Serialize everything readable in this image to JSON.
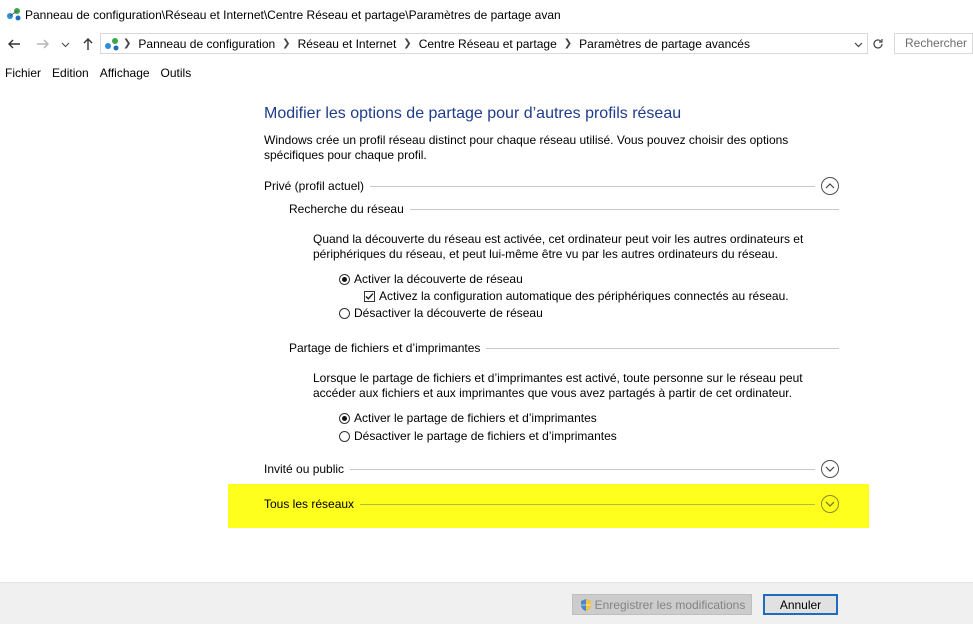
{
  "window": {
    "title": "Panneau de configuration\\Réseau et Internet\\Centre Réseau et partage\\Paramètres de partage avan"
  },
  "nav": {
    "back_icon": "arrow-left-icon",
    "forward_icon": "arrow-right-icon",
    "recent_icon": "chevron-down-icon",
    "up_icon": "arrow-up-icon",
    "breadcrumbs": [
      "Panneau de configuration",
      "Réseau et Internet",
      "Centre Réseau et partage",
      "Paramètres de partage avancés"
    ],
    "search_placeholder": "Rechercher"
  },
  "menu": [
    "Fichier",
    "Edition",
    "Affichage",
    "Outils"
  ],
  "content": {
    "title": "Modifier les options de partage pour d’autres profils réseau",
    "intro": "Windows crée un profil réseau distinct pour chaque réseau utilisé. Vous pouvez choisir des options spécifiques pour chaque profil.",
    "private_profile": {
      "label": "Privé (profil actuel)",
      "expanded": true,
      "network_discovery": {
        "heading": "Recherche du réseau",
        "description": "Quand la découverte du réseau est activée, cet ordinateur peut voir les autres ordinateurs et périphériques du réseau, et peut lui-même être vu par les autres ordinateurs du réseau.",
        "enable_label": "Activer la découverte de réseau",
        "enable_selected": true,
        "auto_config_label": "Activez la configuration automatique des périphériques connectés au réseau.",
        "auto_config_checked": true,
        "disable_label": "Désactiver la découverte de réseau"
      },
      "file_sharing": {
        "heading": "Partage de fichiers et d’imprimantes",
        "description": "Lorsque le partage de fichiers et d’imprimantes est activé, toute personne sur le réseau peut accéder aux fichiers et aux imprimantes que vous avez partagés à partir de cet ordinateur.",
        "enable_label": "Activer le partage de fichiers et d’imprimantes",
        "enable_selected": true,
        "disable_label": "Désactiver le partage de fichiers et d’imprimantes"
      }
    },
    "guest_profile": {
      "label": "Invité ou public",
      "expanded": false
    },
    "all_networks": {
      "label": "Tous les réseaux",
      "expanded": false,
      "highlight_color": "#ffff1e"
    }
  },
  "footer": {
    "save_label": "Enregistrer les modifications",
    "save_enabled": false,
    "save_icon": "shield-icon",
    "cancel_label": "Annuler"
  },
  "colors": {
    "title_blue": "#1e3c8c",
    "highlight": "#ffff1e",
    "footer_bg": "#f0f0f0"
  }
}
